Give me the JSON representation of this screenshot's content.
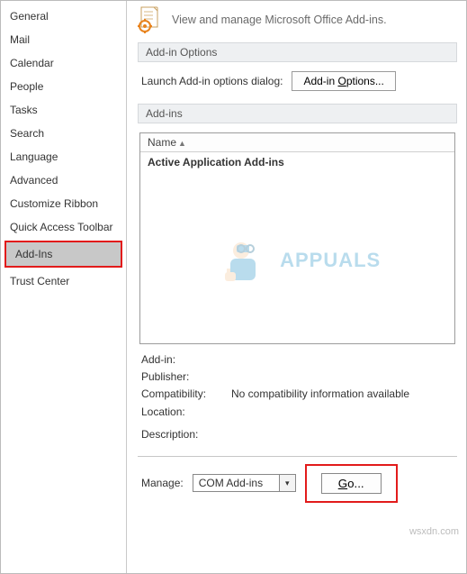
{
  "sidebar": {
    "items": [
      {
        "label": "General"
      },
      {
        "label": "Mail"
      },
      {
        "label": "Calendar"
      },
      {
        "label": "People"
      },
      {
        "label": "Tasks"
      },
      {
        "label": "Search"
      },
      {
        "label": "Language"
      },
      {
        "label": "Advanced"
      },
      {
        "label": "Customize Ribbon"
      },
      {
        "label": "Quick Access Toolbar"
      },
      {
        "label": "Add-Ins"
      },
      {
        "label": "Trust Center"
      }
    ]
  },
  "header": {
    "title": "View and manage Microsoft Office Add-ins."
  },
  "options_section": {
    "title": "Add-in Options",
    "launch_label": "Launch Add-in options dialog:",
    "button_prefix": "Add-in ",
    "button_ul": "O",
    "button_suffix": "ptions..."
  },
  "addins_section": {
    "title": "Add-ins",
    "column_header": "Name",
    "group_label": "Active Application Add-ins"
  },
  "details": {
    "addin_label": "Add-in:",
    "addin_value": "",
    "publisher_label": "Publisher:",
    "publisher_value": "",
    "compat_label": "Compatibility:",
    "compat_value": "No compatibility information available",
    "location_label": "Location:",
    "location_value": "",
    "description_label": "Description:"
  },
  "manage": {
    "label_pre": "Mana",
    "label_ul": "g",
    "label_post": "e:",
    "selected": "COM Add-ins",
    "go_ul": "G",
    "go_post": "o..."
  },
  "watermark_site": "wsxdn.com",
  "watermark_logo": "APPUALS"
}
